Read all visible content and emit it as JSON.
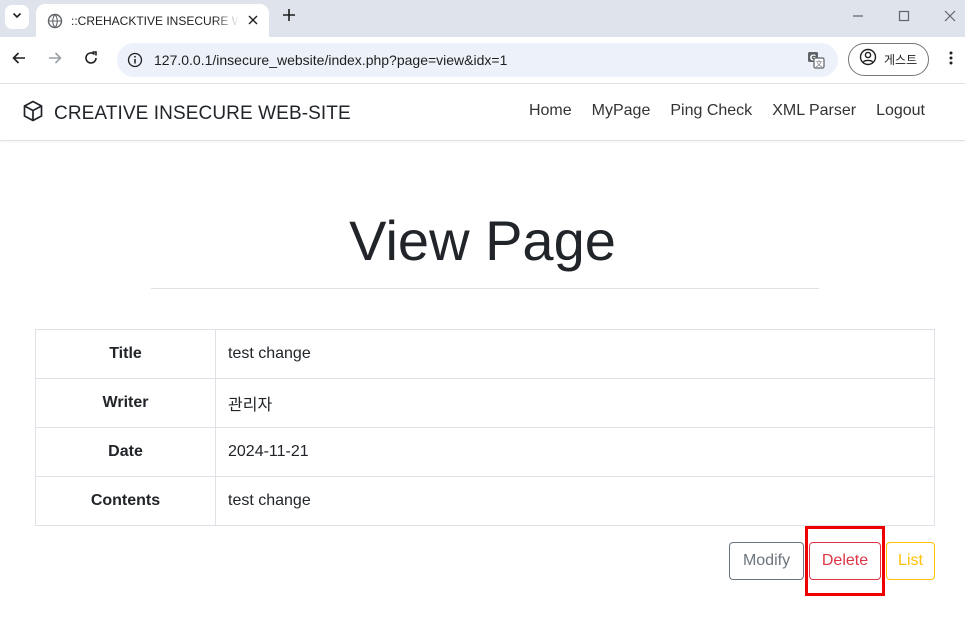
{
  "browser": {
    "tab_title": "::CREHACKTIVE INSECURE WEBSITE",
    "url": "127.0.0.1/insecure_website/index.php?page=view&idx=1",
    "profile_label": "게스트"
  },
  "navbar": {
    "brand": "CREATIVE INSECURE WEB-SITE",
    "links": [
      "Home",
      "MyPage",
      "Ping Check",
      "XML Parser",
      "Logout"
    ]
  },
  "page": {
    "heading": "View Page",
    "rows": [
      {
        "label": "Title",
        "value": "test change"
      },
      {
        "label": "Writer",
        "value": "관리자"
      },
      {
        "label": "Date",
        "value": "2024-11-21"
      },
      {
        "label": "Contents",
        "value": "test change"
      }
    ],
    "buttons": {
      "modify": "Modify",
      "delete": "Delete",
      "list": "List"
    }
  },
  "colors": {
    "secondary": "#6c757d",
    "danger": "#dc3545",
    "warning": "#ffc107",
    "highlight": "#ee0000"
  },
  "icons": {
    "brand": "cube-icon",
    "favicon": "globe-icon",
    "site_info": "info-icon",
    "translate": "translate-icon",
    "profile": "person-circle-icon"
  }
}
